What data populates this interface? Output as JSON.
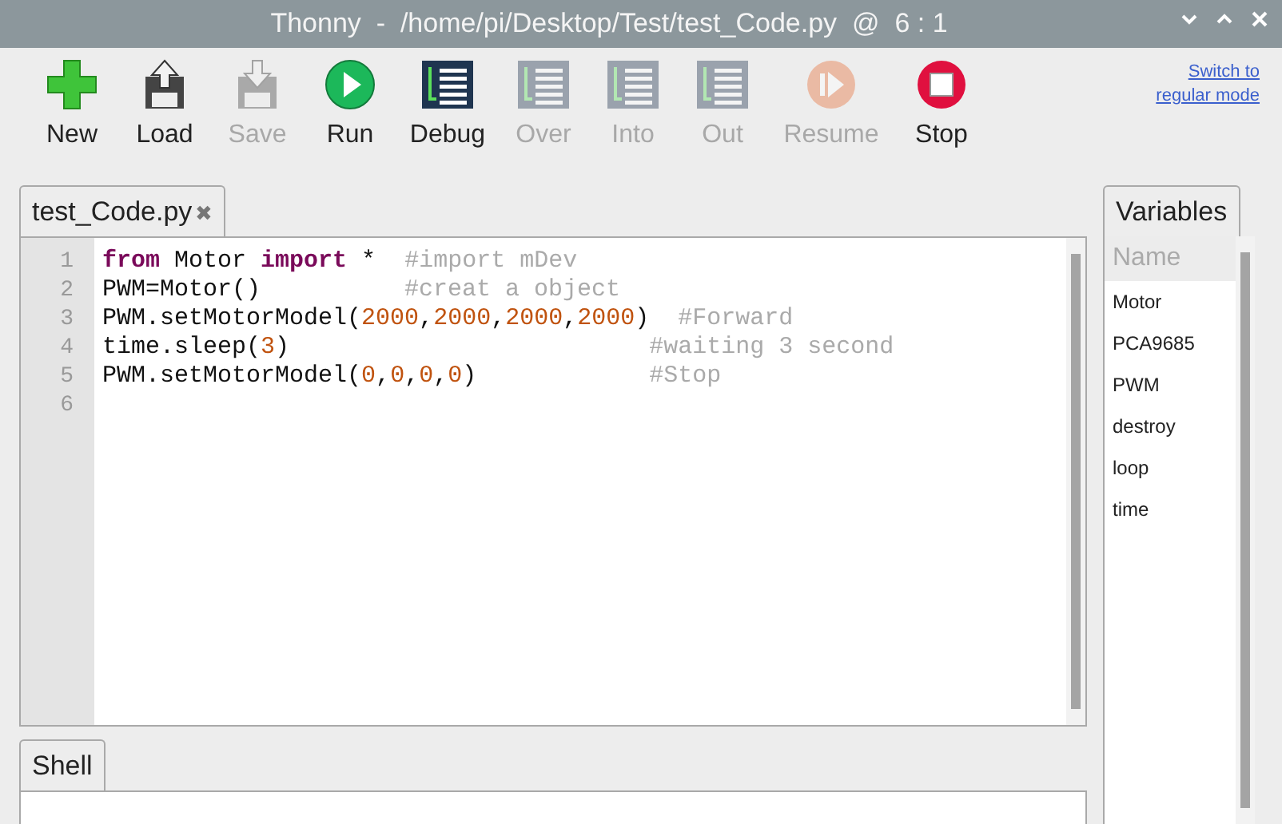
{
  "window": {
    "title": "Thonny  -  /home/pi/Desktop/Test/test_Code.py  @  6 : 1"
  },
  "toolbar": [
    {
      "kind": "new",
      "label": "New",
      "disabled": false
    },
    {
      "kind": "load",
      "label": "Load",
      "disabled": false
    },
    {
      "kind": "save",
      "label": "Save",
      "disabled": true
    },
    {
      "kind": "run",
      "label": "Run",
      "disabled": false
    },
    {
      "kind": "debug",
      "label": "Debug",
      "disabled": false
    },
    {
      "kind": "over",
      "label": "Over",
      "disabled": true
    },
    {
      "kind": "into",
      "label": "Into",
      "disabled": true
    },
    {
      "kind": "out",
      "label": "Out",
      "disabled": true
    },
    {
      "kind": "resume",
      "label": "Resume",
      "disabled": true
    },
    {
      "kind": "stop",
      "label": "Stop",
      "disabled": false
    }
  ],
  "mode_link": {
    "line_1": "Switch to",
    "line_2": "regular mode"
  },
  "editor": {
    "tab": {
      "label": "test_Code.py",
      "close": "✖",
      "selected": true
    },
    "lines": [
      {
        "number": "1",
        "tokens": [
          {
            "kind": "keyword",
            "text": "from"
          },
          {
            "kind": "plain",
            "text": " Motor "
          },
          {
            "kind": "keyword",
            "text": "import"
          },
          {
            "kind": "plain",
            "text": " *  "
          },
          {
            "kind": "comment",
            "text": "#import mDev"
          }
        ]
      },
      {
        "number": "2",
        "tokens": [
          {
            "kind": "plain",
            "text": "PWM=Motor()          "
          },
          {
            "kind": "comment",
            "text": "#creat a object"
          }
        ]
      },
      {
        "number": "3",
        "tokens": [
          {
            "kind": "plain",
            "text": "PWM.setMotorModel("
          },
          {
            "kind": "number",
            "text": "2000"
          },
          {
            "kind": "plain",
            "text": ","
          },
          {
            "kind": "number",
            "text": "2000"
          },
          {
            "kind": "plain",
            "text": ","
          },
          {
            "kind": "number",
            "text": "2000"
          },
          {
            "kind": "plain",
            "text": ","
          },
          {
            "kind": "number",
            "text": "2000"
          },
          {
            "kind": "plain",
            "text": ")  "
          },
          {
            "kind": "comment",
            "text": "#Forward"
          }
        ]
      },
      {
        "number": "4",
        "tokens": [
          {
            "kind": "plain",
            "text": "time.sleep("
          },
          {
            "kind": "number",
            "text": "3"
          },
          {
            "kind": "plain",
            "text": ")                         "
          },
          {
            "kind": "comment",
            "text": "#waiting 3 second"
          }
        ]
      },
      {
        "number": "5",
        "tokens": [
          {
            "kind": "plain",
            "text": "PWM.setMotorModel("
          },
          {
            "kind": "number",
            "text": "0"
          },
          {
            "kind": "plain",
            "text": ","
          },
          {
            "kind": "number",
            "text": "0"
          },
          {
            "kind": "plain",
            "text": ","
          },
          {
            "kind": "number",
            "text": "0"
          },
          {
            "kind": "plain",
            "text": ","
          },
          {
            "kind": "number",
            "text": "0"
          },
          {
            "kind": "plain",
            "text": ")            "
          },
          {
            "kind": "comment",
            "text": "#Stop"
          }
        ]
      },
      {
        "number": "6"
      }
    ]
  },
  "shell": {
    "tab": {
      "label": "Shell",
      "selected": true
    }
  },
  "variables": {
    "tab": {
      "label": "Variables",
      "selected": true
    },
    "header": "Name",
    "items": [
      "Motor",
      "PCA9685",
      "PWM",
      "destroy",
      "loop",
      "time"
    ]
  }
}
